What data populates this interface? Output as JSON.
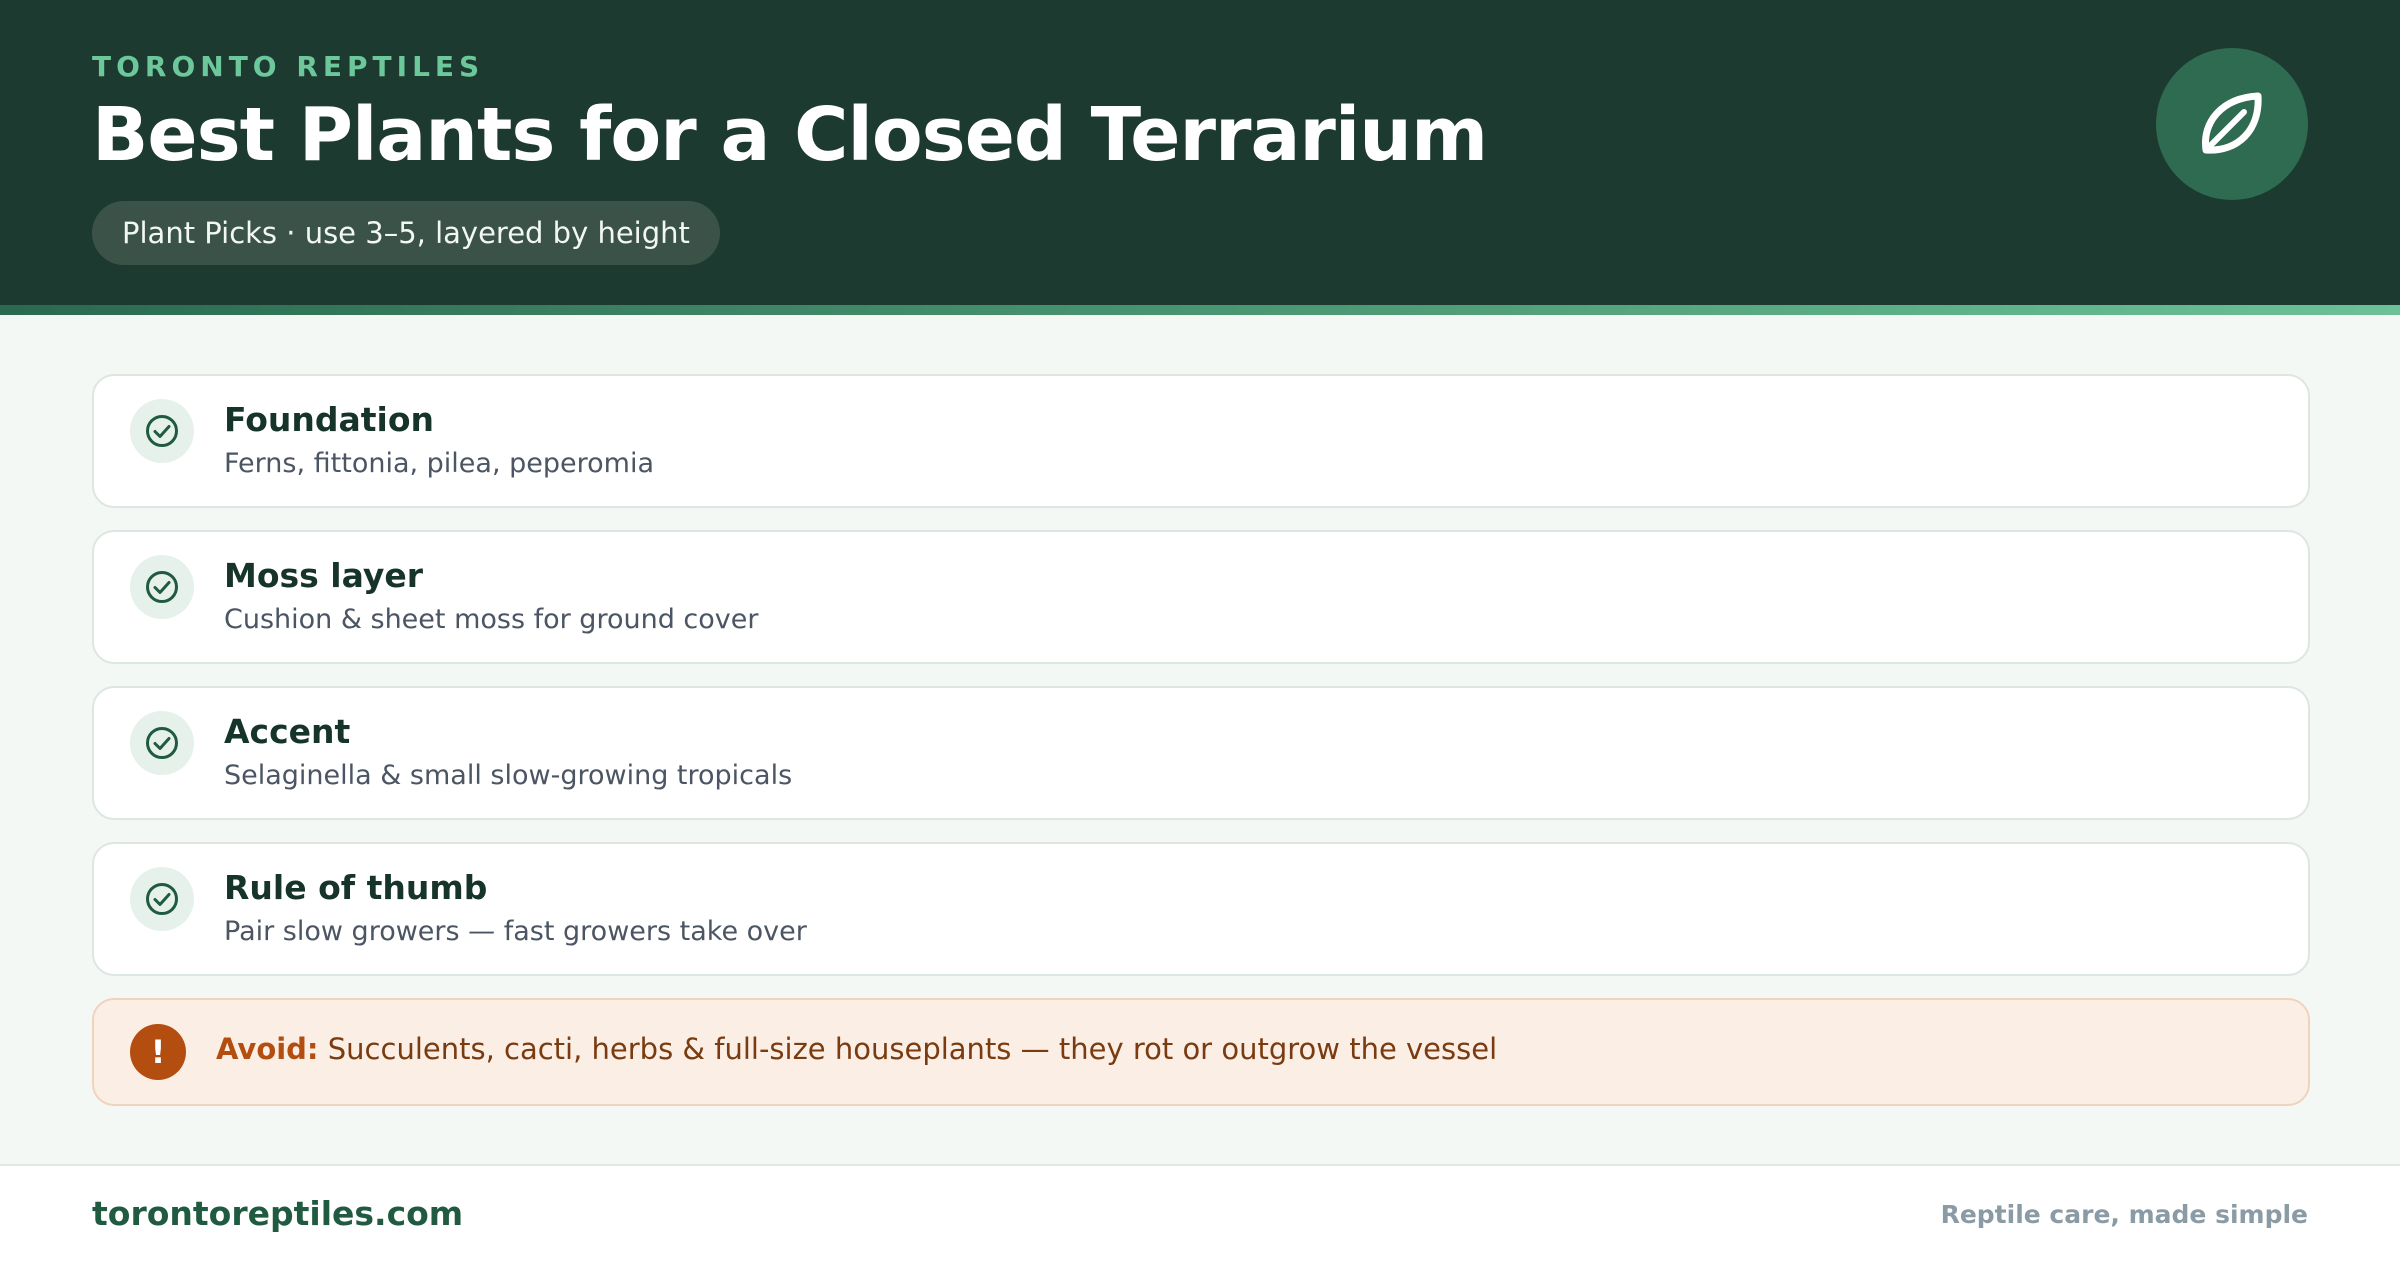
{
  "header": {
    "eyebrow": "TORONTO REPTILES",
    "title": "Best Plants for a Closed Terrarium",
    "pill": "Plant Picks · use 3–5, layered by height",
    "logo_icon": "leaf-icon"
  },
  "items": [
    {
      "title": "Foundation",
      "desc": "Ferns, fittonia, pilea, peperomia",
      "icon": "check-circle-icon"
    },
    {
      "title": "Moss layer",
      "desc": "Cushion & sheet moss for ground cover",
      "icon": "check-circle-icon"
    },
    {
      "title": "Accent",
      "desc": "Selaginella & small slow-growing tropicals",
      "icon": "check-circle-icon"
    },
    {
      "title": "Rule of thumb",
      "desc": "Pair slow growers — fast growers take over",
      "icon": "check-circle-icon"
    }
  ],
  "warning": {
    "icon": "exclamation-icon",
    "label": "Avoid:",
    "text": " Succulents, cacti, herbs & full-size houseplants — they rot or outgrow the vessel"
  },
  "footer": {
    "site": "torontoreptiles.com",
    "tagline": "Reptile care, made simple"
  },
  "colors": {
    "header_bg": "#1d3a30",
    "accent_green": "#6cc79b",
    "warning_bg": "#fbeee5",
    "warning_accent": "#b34e10"
  }
}
